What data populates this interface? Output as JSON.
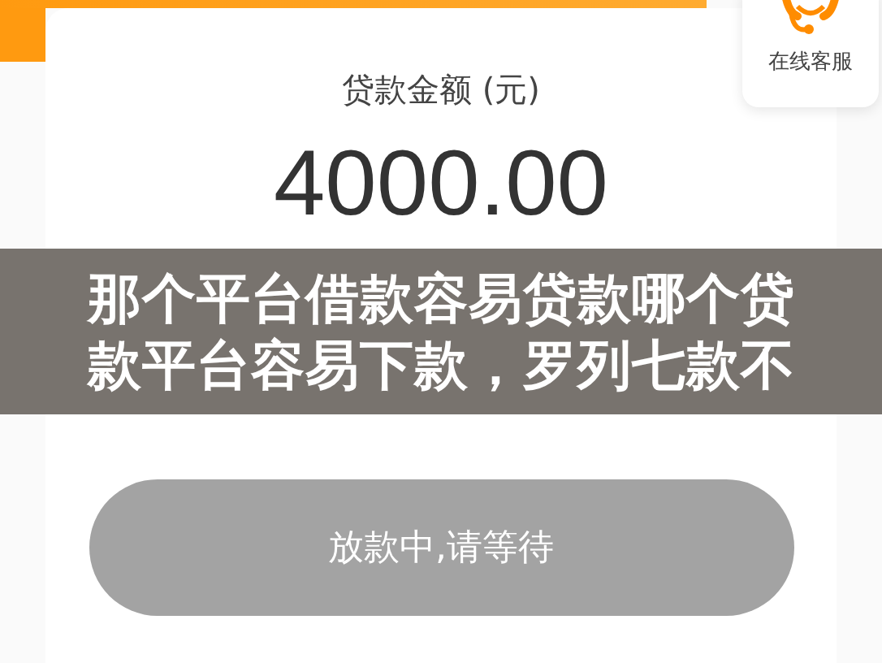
{
  "loan_card": {
    "amount_label": "贷款金额 (元)",
    "amount": "4000.00"
  },
  "support": {
    "label": "在线客服"
  },
  "caption": "那个平台借款容易贷款哪个贷款平台容易下款，罗列七款不",
  "action_button": {
    "label": "放款中,请等待",
    "disabled": true
  }
}
